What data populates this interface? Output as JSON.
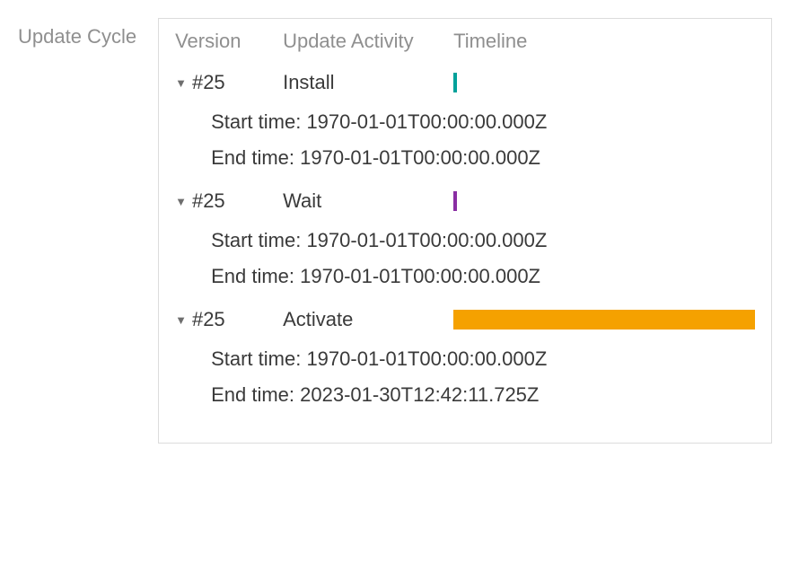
{
  "section_label": "Update Cycle",
  "headers": {
    "version": "Version",
    "activity": "Update Activity",
    "timeline": "Timeline"
  },
  "labels": {
    "start_time": "Start time:",
    "end_time": "End time:"
  },
  "items": [
    {
      "version": "#25",
      "activity": "Install",
      "bar_color": "#00a19a",
      "bar_class": "bar-tiny",
      "start_time": "1970-01-01T00:00:00.000Z",
      "end_time": "1970-01-01T00:00:00.000Z"
    },
    {
      "version": "#25",
      "activity": "Wait",
      "bar_color": "#8a2ea3",
      "bar_class": "bar-tiny",
      "start_time": "1970-01-01T00:00:00.000Z",
      "end_time": "1970-01-01T00:00:00.000Z"
    },
    {
      "version": "#25",
      "activity": "Activate",
      "bar_color": "#f5a100",
      "bar_class": "bar-full",
      "start_time": "1970-01-01T00:00:00.000Z",
      "end_time": "2023-01-30T12:42:11.725Z"
    }
  ]
}
